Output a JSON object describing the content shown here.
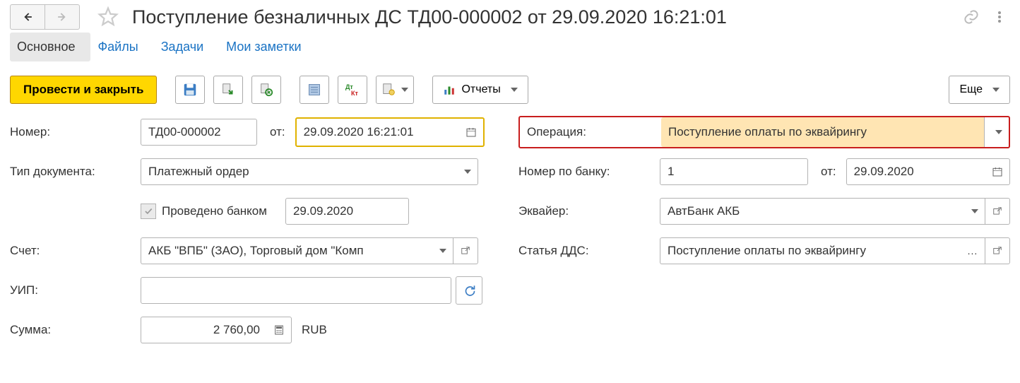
{
  "header": {
    "title": "Поступление безналичных ДС ТД00-000002 от 29.09.2020 16:21:01"
  },
  "tabs": {
    "main": "Основное",
    "files": "Файлы",
    "tasks": "Задачи",
    "notes": "Мои заметки"
  },
  "toolbar": {
    "submit": "Провести и закрыть",
    "reports": "Отчеты",
    "more": "Еще"
  },
  "form": {
    "number_label": "Номер:",
    "number_value": "ТД00-000002",
    "from_label": "от:",
    "date_value": "29.09.2020 16:21:01",
    "operation_label": "Операция:",
    "operation_value": "Поступление оплаты по эквайрингу",
    "doctype_label": "Тип документа:",
    "doctype_value": "Платежный ордер",
    "banknum_label": "Номер по банку:",
    "banknum_value": "1",
    "bankdate_label": "от:",
    "bankdate_value": "29.09.2020",
    "checkbox_label": "Проведено банком",
    "checkdate_value": "29.09.2020",
    "acquirer_label": "Эквайер:",
    "acquirer_value": "АвтБанк АКБ",
    "account_label": "Счет:",
    "account_value": "АКБ \"ВПБ\" (ЗАО), Торговый дом \"Комп",
    "dds_label": "Статья ДДС:",
    "dds_value": "Поступление оплаты по эквайрингу",
    "uip_label": "УИП:",
    "uip_value": "",
    "sum_label": "Сумма:",
    "sum_value": "2 760,00",
    "currency": "RUB"
  }
}
